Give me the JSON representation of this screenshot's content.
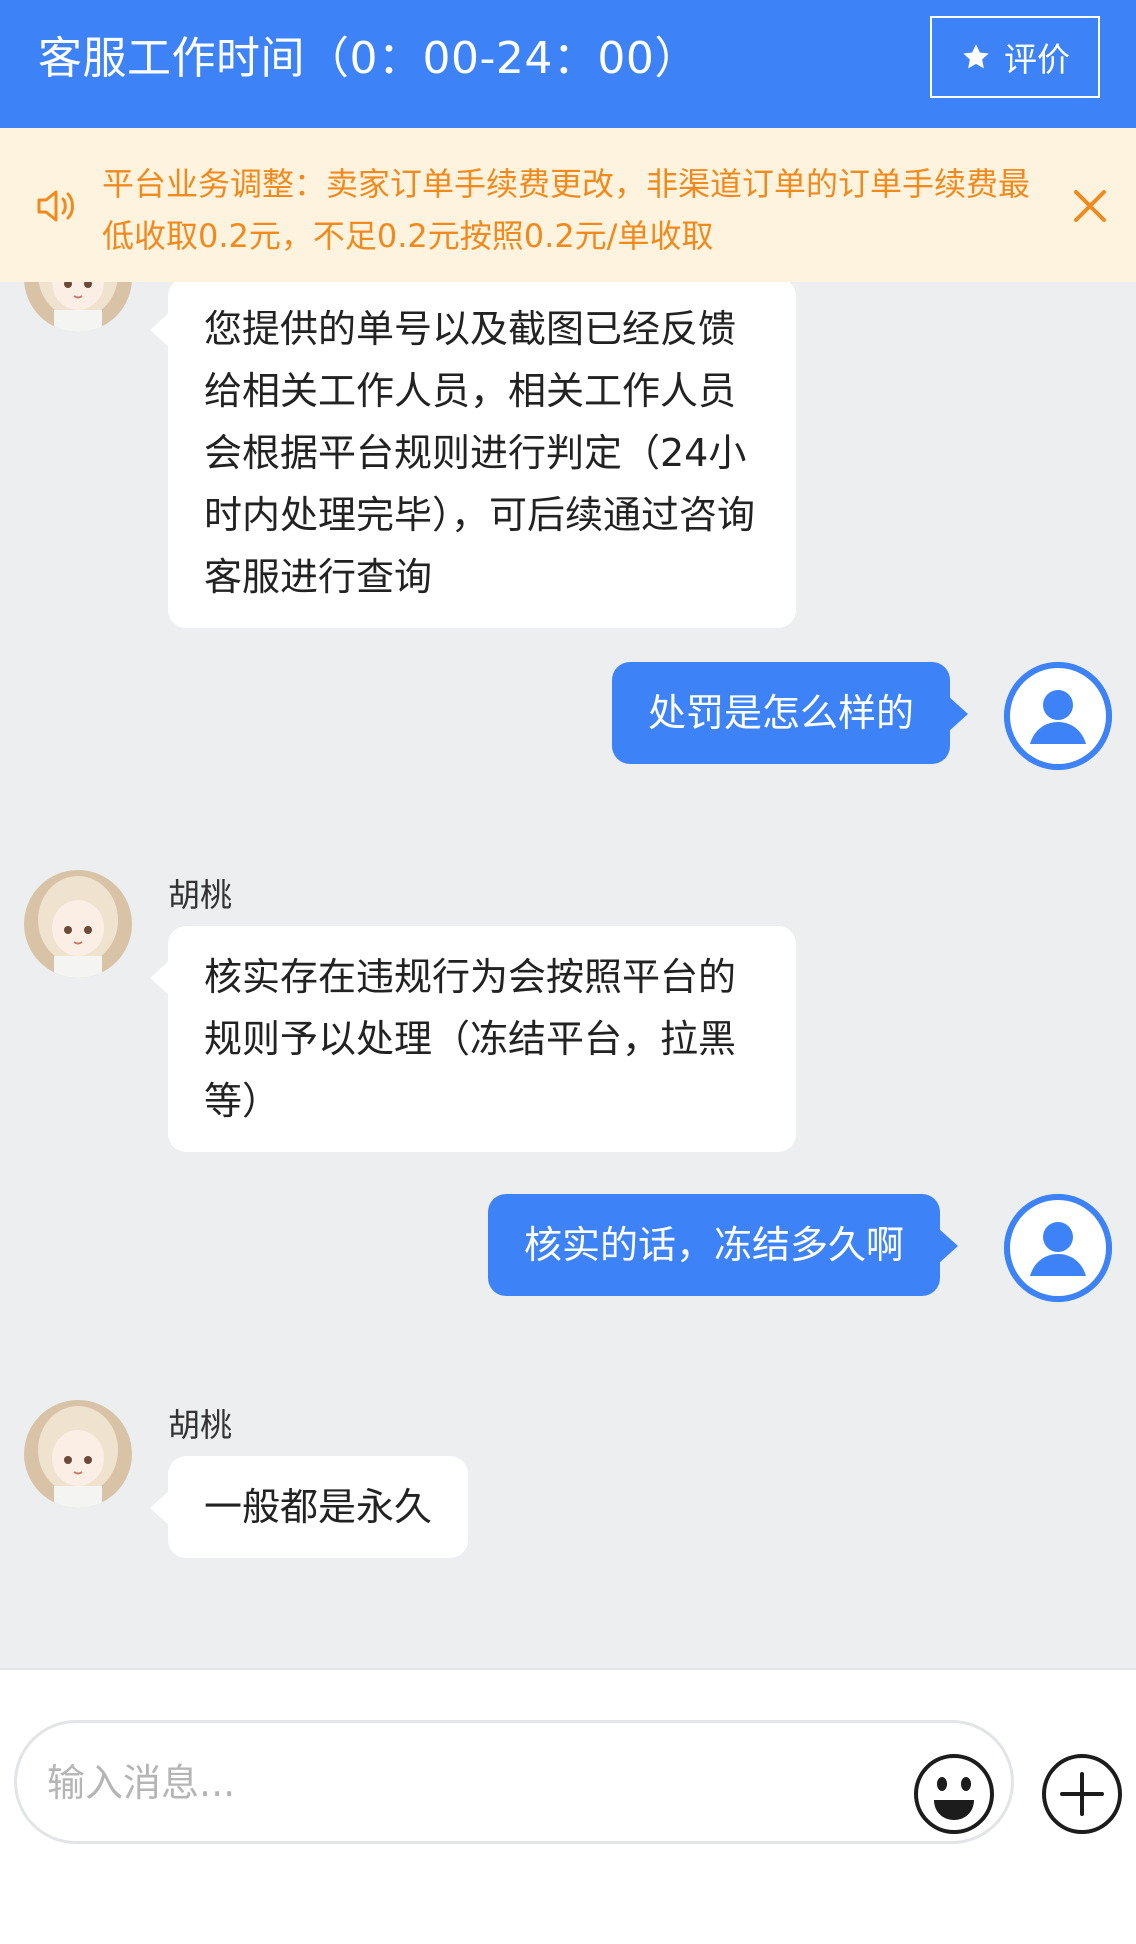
{
  "header": {
    "title": "客服工作时间（0：00-24：00）",
    "rate_label": "评价"
  },
  "notice": {
    "text": "平台业务调整：卖家订单手续费更改，非渠道订单的订单手续费最低收取0.2元，不足0.2元按照0.2元/单收取"
  },
  "messages": [
    {
      "from": "agent",
      "name": "",
      "text": "您提供的单号以及截图已经反馈给相关工作人员，相关工作人员会根据平台规则进行判定（24小时内处理完毕），可后续通过咨询客服进行查询"
    },
    {
      "from": "user",
      "text": "处罚是怎么样的"
    },
    {
      "from": "agent",
      "name": "胡桃",
      "text": "核实存在违规行为会按照平台的规则予以处理（冻结平台，拉黑等）"
    },
    {
      "from": "user",
      "text": "核实的话，冻结多久啊"
    },
    {
      "from": "agent",
      "name": "胡桃",
      "text": "一般都是永久"
    }
  ],
  "composer": {
    "placeholder": "输入消息..."
  },
  "colors": {
    "primary": "#3e82f7",
    "notice_bg": "#fef3df",
    "notice_text": "#f08a1d",
    "chat_bg": "#edeef0"
  }
}
